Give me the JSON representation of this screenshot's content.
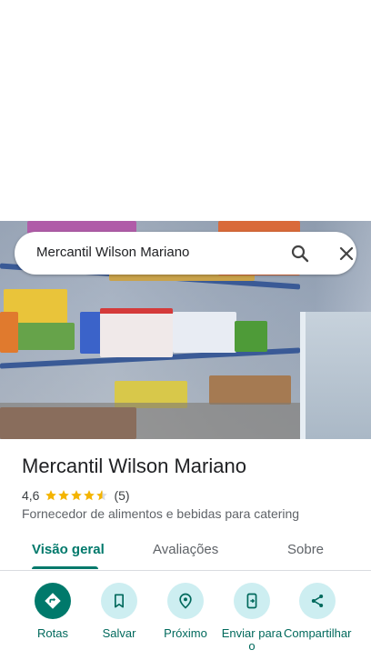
{
  "search": {
    "query": "Mercantil Wilson Mariano"
  },
  "place": {
    "name": "Mercantil Wilson Mariano",
    "rating": "4,6",
    "rating_value": 4.6,
    "review_count": "(5)",
    "category": "Fornecedor de alimentos e bebidas para catering"
  },
  "tabs": [
    {
      "label": "Visão geral",
      "active": true
    },
    {
      "label": "Avaliações",
      "active": false
    },
    {
      "label": "Sobre",
      "active": false
    }
  ],
  "actions": [
    {
      "label": "Rotas",
      "icon": "directions-icon"
    },
    {
      "label": "Salvar",
      "icon": "bookmark-icon"
    },
    {
      "label": "Próximo",
      "icon": "nearby-icon"
    },
    {
      "label": "Enviar para o",
      "icon": "send-to-phone-icon"
    },
    {
      "label": "Compartilhar",
      "icon": "share-icon"
    }
  ],
  "colors": {
    "accent": "#00796b",
    "action_bg": "#cdeef1",
    "star": "#f4b400"
  }
}
